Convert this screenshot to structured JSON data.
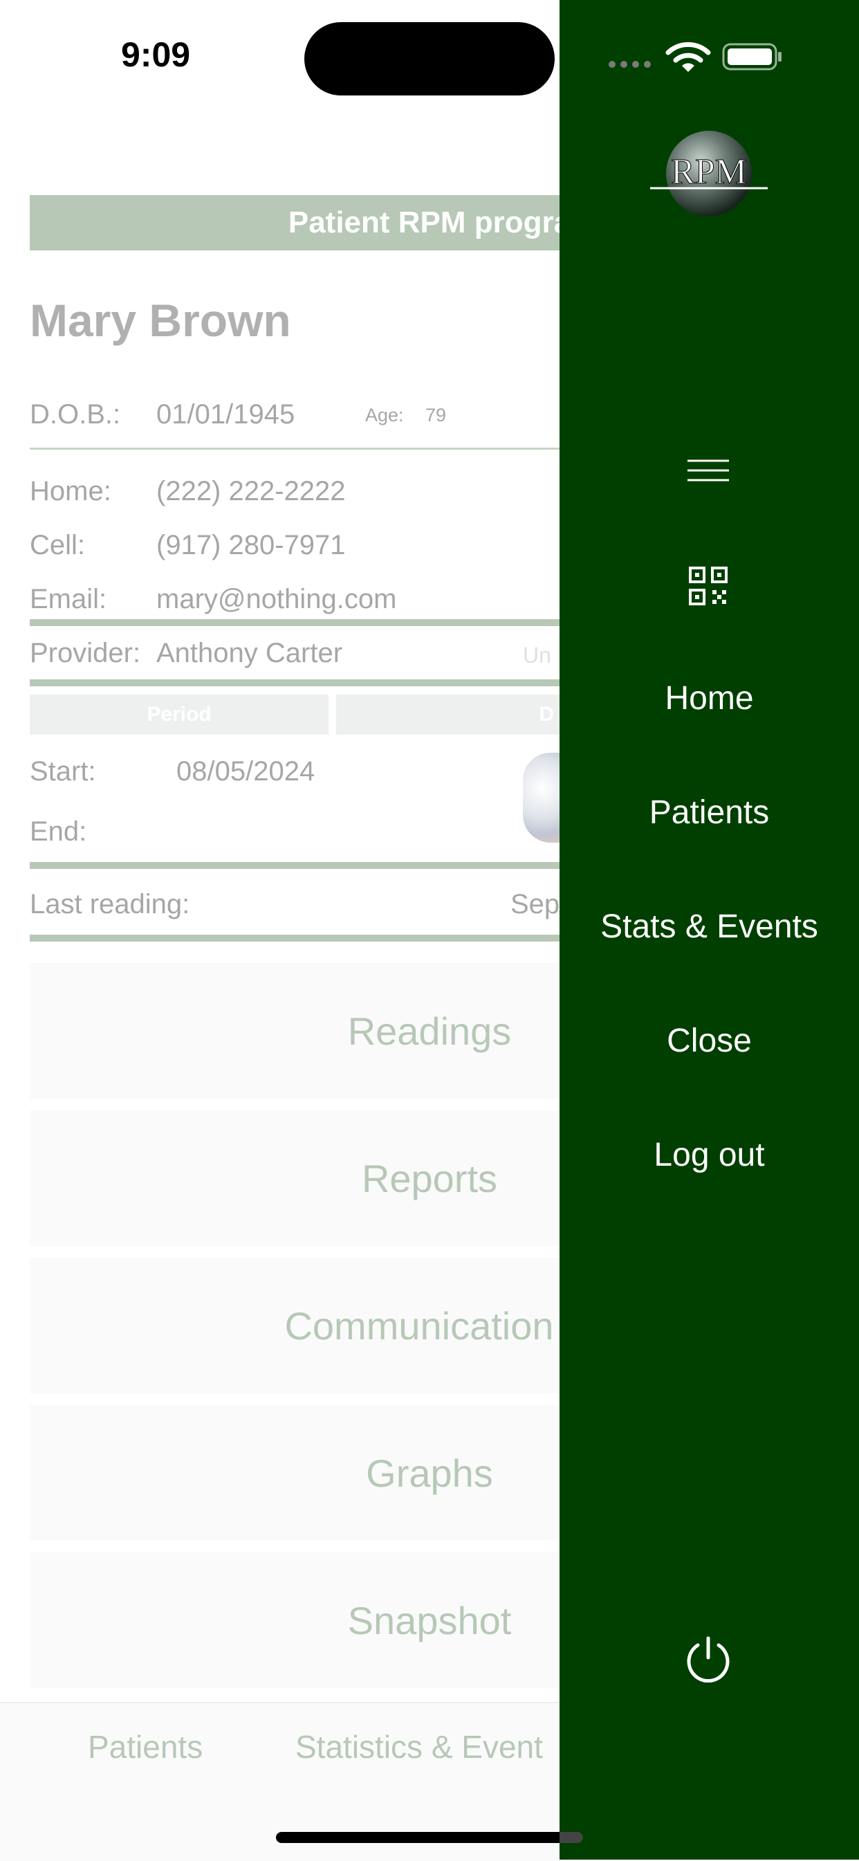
{
  "status_bar": {
    "time": "9:09"
  },
  "patient": {
    "banner": "Patient RPM progra",
    "name": "Mary Brown",
    "dob_label": "D.O.B.:",
    "dob_value": "01/01/1945",
    "age_label": "Age:",
    "age_value": "79",
    "home_label": "Home:",
    "home_value": "(222) 222-2222",
    "cell_label": "Cell:",
    "cell_value": "(917) 280-7971",
    "email_label": "Email:",
    "email_value": "mary@nothing.com",
    "provider_label": "Provider:",
    "provider_value": "Anthony Carter",
    "unread_text": "Un",
    "period_header": "Period",
    "d_header": "D",
    "start_label": "Start:",
    "start_value": "08/05/2024",
    "end_label": "End:",
    "last_reading_label": "Last reading:",
    "last_reading_value": "Sep"
  },
  "cards": [
    {
      "label": "Readings"
    },
    {
      "label": "Reports"
    },
    {
      "label": "Communication"
    },
    {
      "label": "Graphs"
    },
    {
      "label": "Snapshot"
    }
  ],
  "tabbar": {
    "patients": "Patients",
    "stats": "Statistics & Event"
  },
  "drawer": {
    "logo_text": "RPM",
    "menu_icon": "hamburger-menu-icon",
    "qr_icon": "qr-code-icon",
    "items": [
      {
        "label": "Home"
      },
      {
        "label": "Patients"
      },
      {
        "label": "Stats & Events"
      },
      {
        "label": "Close"
      },
      {
        "label": "Log out"
      }
    ],
    "power_icon": "power-icon",
    "background": "#003f00"
  },
  "colors": {
    "accent_green": "#b7c8b6",
    "drawer_green": "#003f00"
  }
}
